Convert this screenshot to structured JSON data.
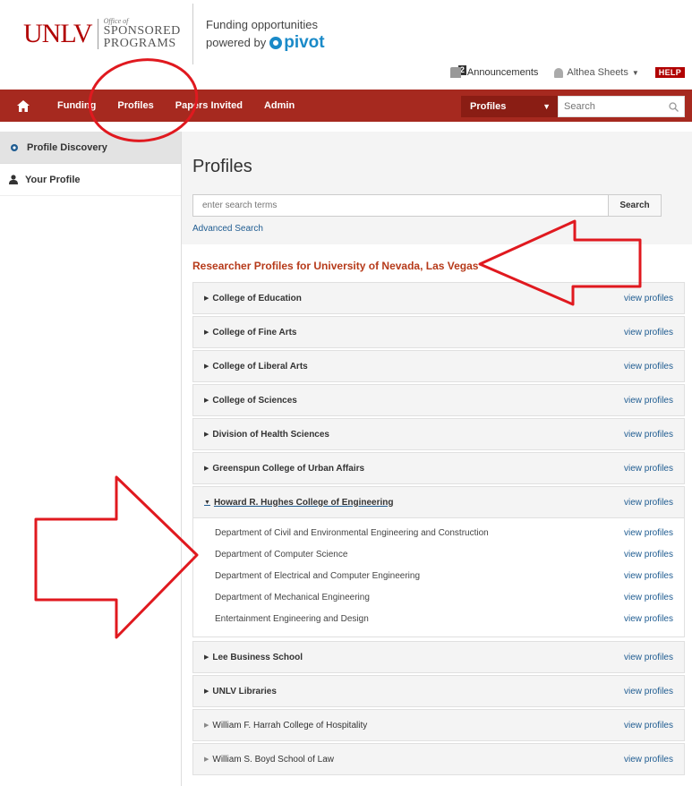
{
  "header": {
    "logo": {
      "unlv": "UNLV",
      "office_of": "Office of",
      "sponsored": "SPONSORED",
      "programs": "PROGRAMS"
    },
    "tagline_line1": "Funding opportunities",
    "tagline_powered": "powered by",
    "pivot": "pivot"
  },
  "util": {
    "announcements_count": "2",
    "announcements": "Announcements",
    "user_name": "Althea Sheets",
    "help": "HELP"
  },
  "nav": {
    "items": [
      "Funding",
      "Profiles",
      "Papers Invited",
      "Admin"
    ],
    "select_value": "Profiles",
    "search_placeholder": "Search"
  },
  "sidebar": {
    "items": [
      "Profile Discovery",
      "Your Profile"
    ]
  },
  "main": {
    "title": "Profiles",
    "search_placeholder": "enter search terms",
    "search_button": "Search",
    "advanced_search": "Advanced Search",
    "researcher_title": "Researcher Profiles for University of Nevada, Las Vegas",
    "view_label": "view profiles",
    "colleges_before": [
      "College of Education",
      "College of Fine Arts",
      "College of Liberal Arts",
      "College of Sciences",
      "Division of Health Sciences",
      "Greenspun College of Urban Affairs"
    ],
    "expanded_college": "Howard R. Hughes College of Engineering",
    "departments": [
      "Department of Civil and Environmental Engineering and Construction",
      "Department of Computer Science",
      "Department of Electrical and Computer Engineering",
      "Department of Mechanical Engineering",
      "Entertainment Engineering and Design"
    ],
    "colleges_after": [
      "Lee Business School",
      "UNLV Libraries"
    ],
    "colleges_light": [
      "William F. Harrah College of Hospitality",
      "William S. Boyd School of Law"
    ]
  },
  "colors": {
    "brand_red": "#a6291f",
    "link_blue": "#1f5c91",
    "title_orange": "#b63a1a",
    "annotation_red": "#e0191f"
  }
}
